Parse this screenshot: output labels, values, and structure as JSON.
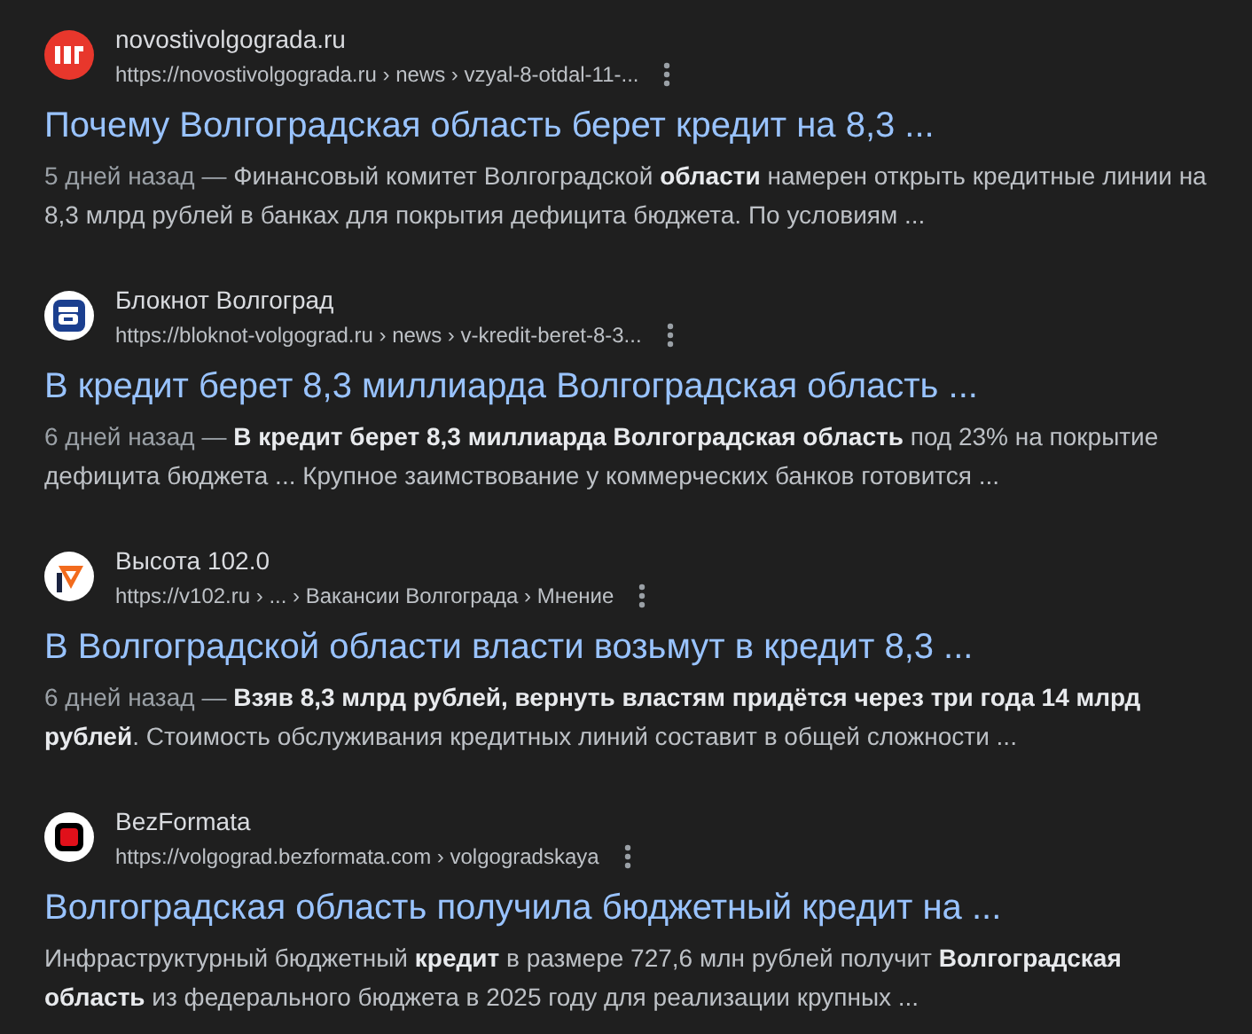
{
  "results": [
    {
      "site": "novostivolgograda.ru",
      "url": "https://novostivolgograda.ru › news › vzyal-8-otdal-11-...",
      "title": "Почему Волгоградская область берет кредит на 8,3 ...",
      "date": "5 дней назад — ",
      "snippet": "Финансовый комитет Волгоградской **области** намерен открыть кредитные линии на 8,3 млрд рублей в банках для покрытия дефицита бюджета. По условиям ..."
    },
    {
      "site": "Блокнот Волгоград",
      "url": "https://bloknot-volgograd.ru › news › v-kredit-beret-8-3...",
      "title": "В кредит берет 8,3 миллиарда Волгоградская область ...",
      "date": "6 дней назад — ",
      "snippet": "**В кредит берет 8,3 миллиарда Волгоградская область** под 23% на покрытие дефицита бюджета ... Крупное заимствование у коммерческих банков готовится ..."
    },
    {
      "site": "Высота 102.0",
      "url": "https://v102.ru › ... › Вакансии Волгограда › Мнение",
      "title": "В Волгоградской области власти возьмут в кредит 8,3 ...",
      "date": "6 дней назад — ",
      "snippet": "**Взяв 8,3 млрд рублей, вернуть властям придётся через три года 14 млрд рублей**. Стоимость обслуживания кредитных линий составит в общей сложности ..."
    },
    {
      "site": "BezFormata",
      "url": "https://volgograd.bezformata.com › volgogradskaya",
      "title": "Волгоградская область получила бюджетный кредит на ...",
      "snippet": "Инфраструктурный бюджетный **кредит** в размере 727,6 млн рублей получит **Волгоградская область** из федерального бюджета в 2025 году для реализации крупных ..."
    }
  ]
}
